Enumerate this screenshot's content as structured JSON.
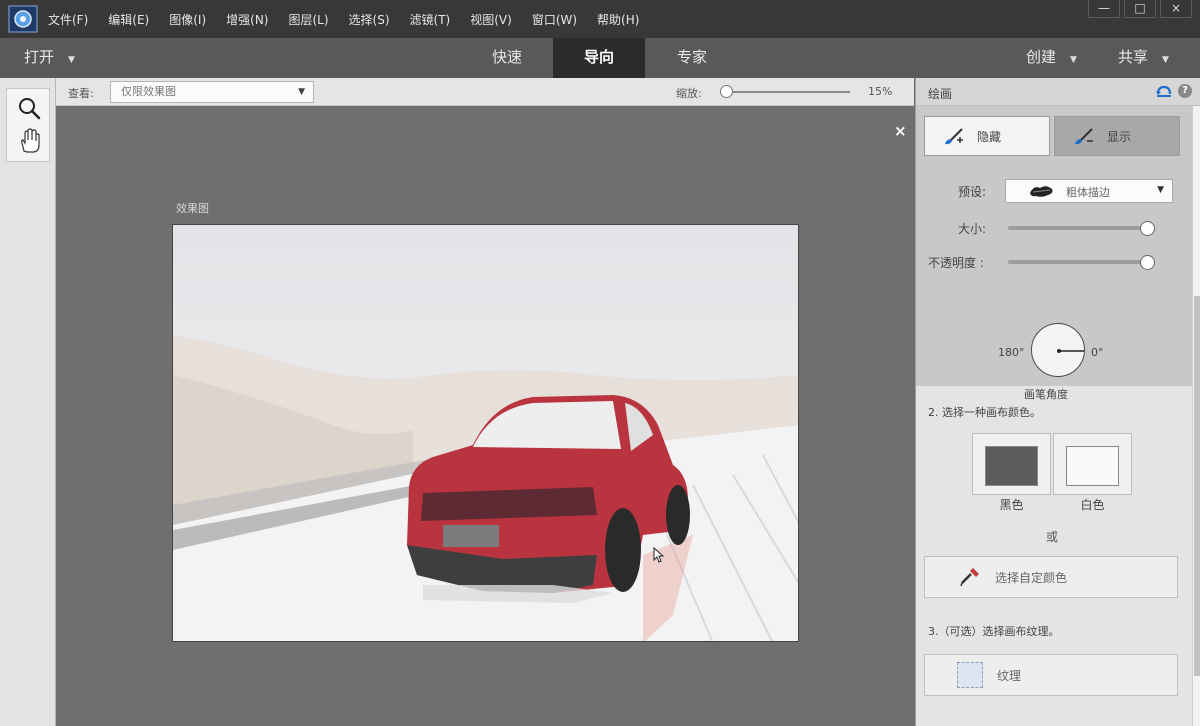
{
  "menubar": {
    "items": [
      "文件(F)",
      "编辑(E)",
      "图像(I)",
      "增强(N)",
      "图层(L)",
      "选择(S)",
      "滤镜(T)",
      "视图(V)",
      "窗口(W)",
      "帮助(H)"
    ],
    "window_controls": [
      "—",
      "□",
      "×"
    ]
  },
  "modebar": {
    "open_label": "打开",
    "tabs": [
      "快速",
      "导向",
      "专家"
    ],
    "active_tab": "导向",
    "create_label": "创建",
    "share_label": "共享"
  },
  "viewbar": {
    "view_label": "查看:",
    "view_value": "仅限效果图",
    "zoom_label": "缩放:",
    "zoom_value": "15%",
    "zoom_level_percent": 15
  },
  "canvas": {
    "after_label": "效果图",
    "close_glyph": "×"
  },
  "panel": {
    "title": "绘画",
    "help_glyph": "?",
    "hide_label": "隐藏",
    "show_label": "显示",
    "preset_label": "预设:",
    "preset_value": "粗体描边",
    "size_label": "大小:",
    "size_value_percent": 100,
    "opacity_label": "不透明度 :",
    "opacity_value_percent": 100,
    "angle_left": "180°",
    "angle_right": "0°",
    "angle_value_deg": 0,
    "angle_label": "画笔角度",
    "step2": "2. 选择一种画布颜色。",
    "black_label": "黑色",
    "white_label": "白色",
    "or_label": "或",
    "custom_color_label": "选择自定颜色",
    "step3": "3.（可选）选择画布纹理。",
    "texture_label": "纹理"
  },
  "colors": {
    "menubar_bg": "#383838",
    "modebar_bg": "#595959",
    "active_tab_bg": "#2b2b2b",
    "canvas_bg": "#6f6f6f",
    "black_swatch": "#5a5d5b",
    "white_swatch": "#fafafa"
  }
}
